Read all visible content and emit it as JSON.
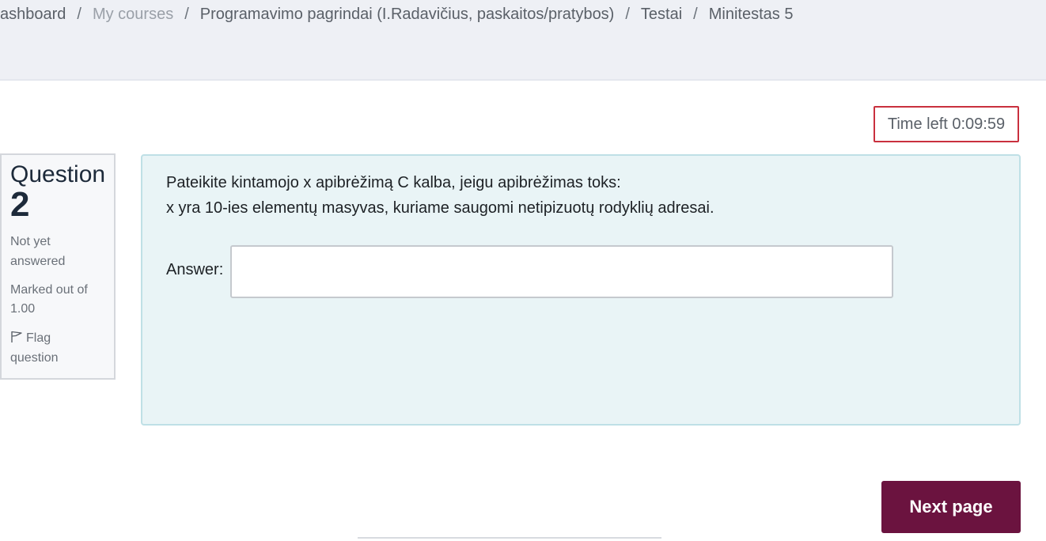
{
  "breadcrumb": {
    "items": [
      "ashboard",
      "My courses",
      "Programavimo pagrindai (I.Radavičius, paskaitos/pratybos)",
      "Testai",
      "Minitestas 5"
    ],
    "separator": "/"
  },
  "timer": {
    "text": "Time left 0:09:59"
  },
  "question_info": {
    "label": "Question",
    "number": "2",
    "state_line1": "Not yet",
    "state_line2": "answered",
    "grade_line1": "Marked out of",
    "grade_line2": "1.00",
    "flag_line1": "Flag",
    "flag_line2": "question",
    "flag_icon": "flag-icon"
  },
  "question": {
    "line1": "Pateikite kintamojo x apibrėžimą C kalba, jeigu apibrėžimas toks:",
    "line2": "x yra 10-ies elementų masyvas, kuriame saugomi netipizuotų rodyklių adresai.",
    "answer_label": "Answer:",
    "answer_value": ""
  },
  "navigation": {
    "next_label": "Next page"
  },
  "colors": {
    "primary": "#6b133f",
    "timer_border": "#c9303e",
    "question_bg": "#e9f4f6"
  }
}
